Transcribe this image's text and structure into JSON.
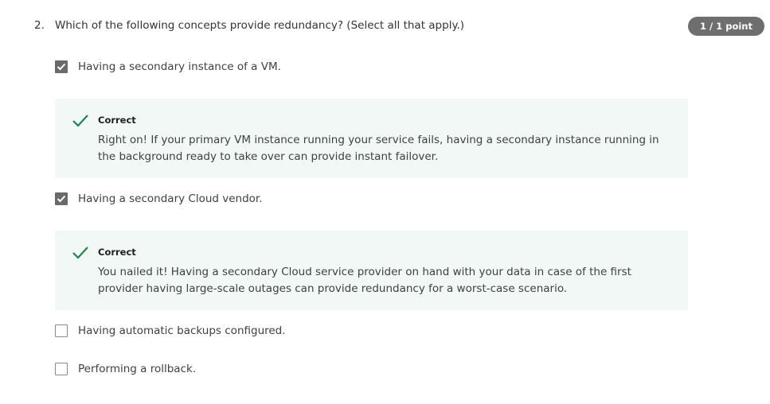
{
  "question": {
    "number": "2.",
    "text": "Which of the following concepts provide redundancy? (Select all that apply.)",
    "score": "1 / 1 point"
  },
  "options": [
    {
      "label": "Having a secondary instance of a VM.",
      "checked": true,
      "feedback": {
        "title": "Correct",
        "body": "Right on! If your primary VM instance running your service fails, having a secondary instance running in the background ready to take over can provide instant failover."
      }
    },
    {
      "label": "Having a secondary Cloud vendor.",
      "checked": true,
      "feedback": {
        "title": "Correct",
        "body": "You nailed it! Having a secondary Cloud service provider on hand with your data in case of the first provider having large-scale outages can provide redundancy for a worst-case scenario."
      }
    },
    {
      "label": "Having automatic backups configured.",
      "checked": false
    },
    {
      "label": "Performing a rollback.",
      "checked": false
    }
  ],
  "icons": {
    "checkbox_checked": "checkmark-icon",
    "feedback_correct": "correct-check-icon"
  },
  "colors": {
    "correct_green": "#1f8354",
    "feedback_bg": "#f2f8f5",
    "badge_bg": "#6e6e6e",
    "checkbox_checked_bg": "#6a6a6a"
  }
}
